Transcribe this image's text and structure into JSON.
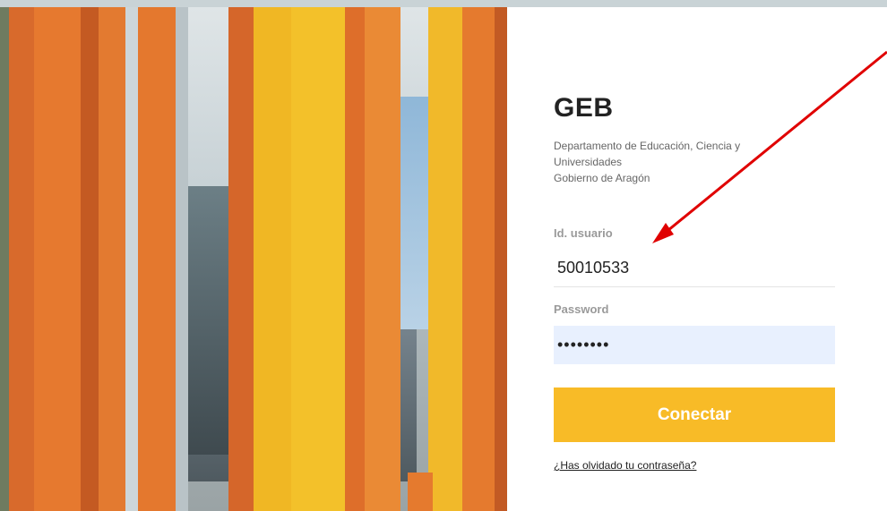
{
  "login": {
    "brand": "GEB",
    "org_line1": "Departamento de Educación, Ciencia y Universidades",
    "org_line2": "Gobierno de Aragón",
    "user_label": "Id. usuario",
    "user_value": "50010533",
    "password_label": "Password",
    "password_value": "••••••••",
    "submit_label": "Conectar",
    "forgot_label": "¿Has olvidado tu contraseña?"
  },
  "colors": {
    "accent": "#f8bb27",
    "autofill": "#e8f0fe",
    "annotation": "#e00000"
  }
}
